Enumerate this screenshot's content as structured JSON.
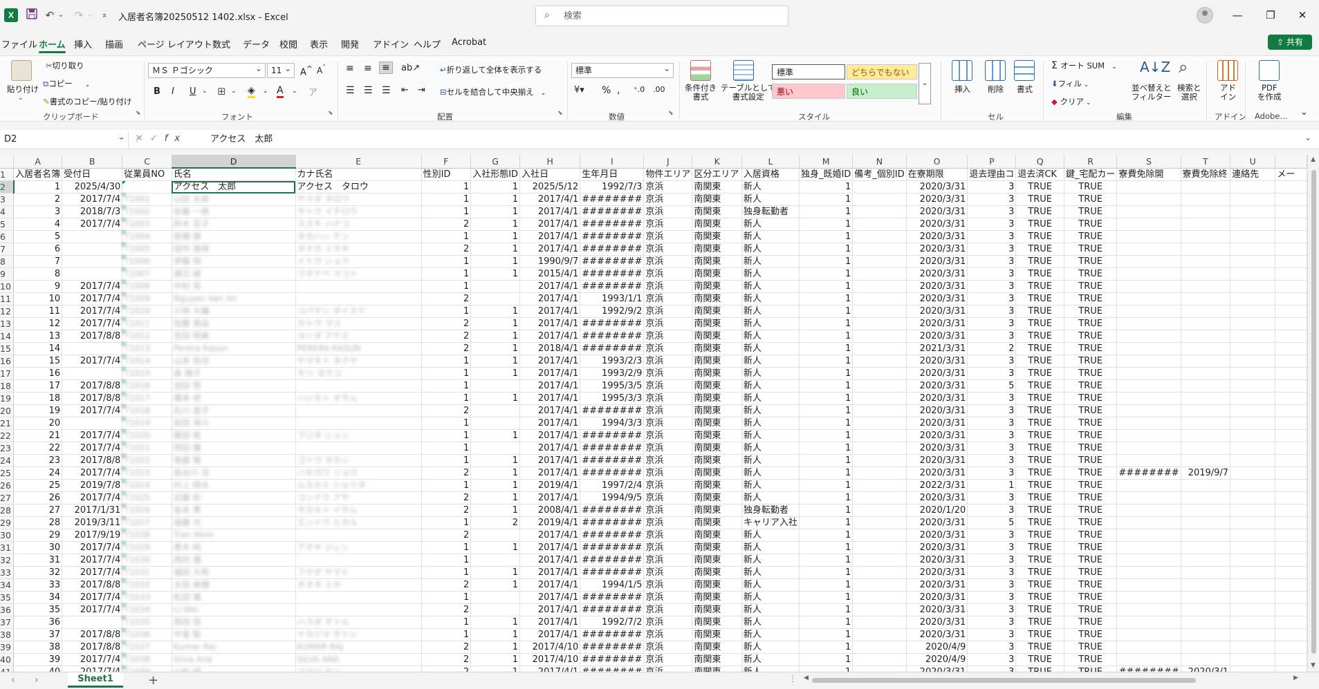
{
  "titlebar": {
    "app_logo": "X",
    "doc_title": "入居者名簿20250512 1402.xlsx  -  Excel",
    "search_placeholder": "検索"
  },
  "menu": {
    "tabs": [
      "ファイル",
      "ホーム",
      "挿入",
      "描画",
      "ページ レイアウト",
      "数式",
      "データ",
      "校閲",
      "表示",
      "開発",
      "アドイン",
      "ヘルプ",
      "Acrobat"
    ],
    "share_label": "共有"
  },
  "ribbon": {
    "clipboard": {
      "paste": "貼り付け",
      "cut": "切り取り",
      "copy": "コピー",
      "format_painter": "書式のコピー/貼り付け",
      "group": "クリップボード"
    },
    "font": {
      "name": "ＭＳ Ｐゴシック",
      "size": "11",
      "group": "フォント"
    },
    "alignment": {
      "wrap": "折り返して全体を表示する",
      "merge": "セルを結合して中央揃え",
      "group": "配置"
    },
    "number": {
      "format": "標準",
      "group": "数値"
    },
    "styles": {
      "conditional": "条件付き\n書式",
      "table": "テーブルとして\n書式設定",
      "normal": "標準",
      "neutral": "どちらでもない",
      "bad": "悪い",
      "good": "良い",
      "group": "スタイル"
    },
    "cells": {
      "insert": "挿入",
      "delete": "削除",
      "format": "書式",
      "group": "セル"
    },
    "editing": {
      "autosum": "オート SUM",
      "fill": "フィル",
      "clear": "クリア",
      "sort": "並べ替えと\nフィルター",
      "find": "検索と\n選択",
      "group": "編集"
    },
    "addins": {
      "addin": "アド\nイン",
      "group": "アドイン"
    },
    "adobe": {
      "pdf": "PDF\nを作成",
      "group": "Adobe..."
    }
  },
  "formula_bar": {
    "name_box": "D2",
    "formula": "アクセス　太郎"
  },
  "grid": {
    "columns": [
      "A",
      "B",
      "C",
      "D",
      "E",
      "F",
      "G",
      "H",
      "I",
      "J",
      "K",
      "L",
      "M",
      "N",
      "O",
      "P",
      "Q",
      "R",
      "S",
      "T",
      "U",
      ""
    ],
    "header_row": [
      "入居者名簿",
      "受付日",
      "従業員NO",
      "氏名",
      "カナ氏名",
      "性別ID",
      "入社形態ID",
      "入社日",
      "生年月日",
      "物件エリア",
      "区分エリア",
      "入居資格",
      "独身_既婚ID",
      "備考_個別ID",
      "在寮期限",
      "退去理由コ",
      "退去済CK",
      "鍵_宅配カー",
      "寮費免除開",
      "寮費免除終",
      "連絡先",
      "メー"
    ],
    "row_numbers": [
      "1",
      "2",
      "3",
      "4",
      "5",
      "6",
      "7",
      "8",
      "9",
      "10",
      "11",
      "12",
      "13",
      "14",
      "15",
      "16",
      "17",
      "18",
      "19",
      "20",
      "21",
      "22",
      "23",
      "24",
      "25",
      "26",
      "27",
      "28",
      "29",
      "30",
      "31",
      "32",
      "33",
      "34",
      "35",
      "36",
      "37",
      "38",
      "39",
      "40",
      "41"
    ],
    "rows": [
      [
        "1",
        "2025/4/30",
        "",
        "アクセス　太郎",
        "アクセス　タロウ",
        "1",
        "1",
        "2025/5/12",
        "1992/7/3",
        "京浜",
        "南関東",
        "新人",
        "1",
        "",
        "2020/3/31",
        "3",
        "TRUE",
        "TRUE",
        "",
        "",
        "",
        ""
      ],
      [
        "2",
        "2017/7/4",
        "T1001",
        "山田 太郎",
        "ヤマダ タロウ",
        "1",
        "1",
        "2017/4/1",
        "########",
        "京浜",
        "南関東",
        "新人",
        "1",
        "",
        "2020/3/31",
        "3",
        "TRUE",
        "TRUE",
        "",
        "",
        "",
        ""
      ],
      [
        "3",
        "2018/7/3",
        "T1002",
        "佐藤 一郎",
        "サトウ イチロウ",
        "1",
        "1",
        "2017/4/1",
        "########",
        "京浜",
        "南関東",
        "独身転勤者",
        "1",
        "",
        "2020/3/31",
        "3",
        "TRUE",
        "TRUE",
        "",
        "",
        "",
        ""
      ],
      [
        "4",
        "2017/7/4",
        "T1003",
        "鈴木 花子",
        "スズキ ハナコ",
        "2",
        "1",
        "2017/4/1",
        "########",
        "京浜",
        "南関東",
        "新人",
        "1",
        "",
        "2020/3/31",
        "3",
        "TRUE",
        "TRUE",
        "",
        "",
        "",
        ""
      ],
      [
        "5",
        "",
        "T1004",
        "高橋 健",
        "タカハシ ケン",
        "1",
        "1",
        "2017/4/1",
        "########",
        "京浜",
        "南関東",
        "新人",
        "1",
        "",
        "2020/3/31",
        "3",
        "TRUE",
        "TRUE",
        "",
        "",
        "",
        ""
      ],
      [
        "6",
        "",
        "T1005",
        "田中 美咲",
        "タナカ ミサキ",
        "2",
        "1",
        "2017/4/1",
        "########",
        "京浜",
        "南関東",
        "新人",
        "1",
        "",
        "2020/3/31",
        "3",
        "TRUE",
        "TRUE",
        "",
        "",
        "",
        ""
      ],
      [
        "7",
        "",
        "T1006",
        "伊藤 翔",
        "イトウ ショウ",
        "1",
        "1",
        "1990/9/7",
        "########",
        "京浜",
        "南関東",
        "新人",
        "1",
        "",
        "2020/3/31",
        "3",
        "TRUE",
        "TRUE",
        "",
        "",
        "",
        ""
      ],
      [
        "8",
        "",
        "T1007",
        "渡辺 誠",
        "ワタナベ マコト",
        "1",
        "1",
        "2015/4/1",
        "########",
        "京浜",
        "南関東",
        "新人",
        "1",
        "",
        "2020/3/31",
        "3",
        "TRUE",
        "TRUE",
        "",
        "",
        "",
        ""
      ],
      [
        "9",
        "2017/7/4",
        "T1008",
        "中村 亮",
        "",
        "1",
        "",
        "2017/4/1",
        "########",
        "京浜",
        "南関東",
        "新人",
        "1",
        "",
        "2020/3/31",
        "3",
        "TRUE",
        "TRUE",
        "",
        "",
        "",
        ""
      ],
      [
        "10",
        "2017/7/4",
        "T1009",
        "Nguyen Van An",
        "",
        "2",
        "",
        "2017/4/1",
        "1993/1/1",
        "京浜",
        "南関東",
        "新人",
        "1",
        "",
        "2020/3/31",
        "3",
        "TRUE",
        "TRUE",
        "",
        "",
        "",
        ""
      ],
      [
        "11",
        "2017/7/4",
        "T1010",
        "小林 大輔",
        "コバヤシ ダイスケ",
        "1",
        "1",
        "2017/4/1",
        "1992/9/2",
        "京浜",
        "南関東",
        "新人",
        "1",
        "",
        "2020/3/31",
        "3",
        "TRUE",
        "TRUE",
        "",
        "",
        "",
        ""
      ],
      [
        "12",
        "2017/7/4",
        "T1011",
        "加藤 真由",
        "カトウ マユ",
        "2",
        "1",
        "2017/4/1",
        "########",
        "京浜",
        "南関東",
        "新人",
        "1",
        "",
        "2020/3/31",
        "3",
        "TRUE",
        "TRUE",
        "",
        "",
        "",
        ""
      ],
      [
        "13",
        "2017/8/8",
        "T1012",
        "吉田 明美",
        "ヨシダ アケミ",
        "2",
        "1",
        "2017/4/1",
        "########",
        "京浜",
        "南関東",
        "新人",
        "1",
        "",
        "2020/3/31",
        "3",
        "TRUE",
        "TRUE",
        "",
        "",
        "",
        ""
      ],
      [
        "14",
        "",
        "T1013",
        "Perera Kasun",
        "PERERA KASUN",
        "2",
        "1",
        "2018/4/1",
        "########",
        "京浜",
        "南関東",
        "新人",
        "1",
        "",
        "2021/3/31",
        "2",
        "TRUE",
        "TRUE",
        "",
        "",
        "",
        ""
      ],
      [
        "15",
        "2017/7/4",
        "T1014",
        "山本 拓也",
        "ヤマモト タクヤ",
        "1",
        "1",
        "2017/4/1",
        "1993/2/3",
        "京浜",
        "南関東",
        "新人",
        "1",
        "",
        "2020/3/31",
        "3",
        "TRUE",
        "TRUE",
        "",
        "",
        "",
        ""
      ],
      [
        "16",
        "",
        "T1015",
        "森 陽子",
        "モリ ヨウコ",
        "1",
        "1",
        "2017/4/1",
        "1993/2/9",
        "京浜",
        "南関東",
        "新人",
        "1",
        "",
        "2020/3/31",
        "3",
        "TRUE",
        "TRUE",
        "",
        "",
        "",
        ""
      ],
      [
        "17",
        "2017/8/8",
        "T1016",
        "池田 悠",
        "",
        "1",
        "",
        "2017/4/1",
        "1995/3/5",
        "京浜",
        "南関東",
        "新人",
        "1",
        "",
        "2020/3/31",
        "5",
        "TRUE",
        "TRUE",
        "",
        "",
        "",
        ""
      ],
      [
        "18",
        "2017/8/8",
        "T1017",
        "橋本 修",
        "ハシモト オサム",
        "1",
        "1",
        "2017/4/1",
        "1995/3/3",
        "京浜",
        "南関東",
        "新人",
        "1",
        "",
        "2020/3/31",
        "3",
        "TRUE",
        "TRUE",
        "",
        "",
        "",
        ""
      ],
      [
        "19",
        "2017/7/4",
        "T1018",
        "石川 直子",
        "",
        "2",
        "",
        "2017/4/1",
        "########",
        "京浜",
        "南関東",
        "新人",
        "1",
        "",
        "2020/3/31",
        "3",
        "TRUE",
        "TRUE",
        "",
        "",
        "",
        ""
      ],
      [
        "20",
        "",
        "T1019",
        "前田 海斗",
        "",
        "1",
        "",
        "2017/4/1",
        "1994/3/3",
        "京浜",
        "南関東",
        "新人",
        "1",
        "",
        "2020/3/31",
        "3",
        "TRUE",
        "TRUE",
        "",
        "",
        "",
        ""
      ],
      [
        "21",
        "2017/7/4",
        "T1020",
        "藤田 俊",
        "フジタ シュン",
        "1",
        "1",
        "2017/4/1",
        "########",
        "京浜",
        "南関東",
        "新人",
        "1",
        "",
        "2020/3/31",
        "3",
        "TRUE",
        "TRUE",
        "",
        "",
        "",
        ""
      ],
      [
        "22",
        "2017/7/4",
        "T1021",
        "岡田 優",
        "",
        "1",
        "",
        "2017/4/1",
        "########",
        "京浜",
        "南関東",
        "新人",
        "1",
        "",
        "2020/3/31",
        "3",
        "TRUE",
        "TRUE",
        "",
        "",
        "",
        ""
      ],
      [
        "23",
        "2017/8/8",
        "T1022",
        "後藤 隆",
        "ゴトウ タカシ",
        "1",
        "1",
        "2017/4/1",
        "########",
        "京浜",
        "南関東",
        "新人",
        "1",
        "",
        "2020/3/31",
        "3",
        "TRUE",
        "TRUE",
        "",
        "",
        "",
        ""
      ],
      [
        "24",
        "2017/7/4",
        "T1023",
        "長谷川 涼",
        "ハセガワ リョウ",
        "2",
        "1",
        "2017/4/1",
        "########",
        "京浜",
        "南関東",
        "新人",
        "1",
        "",
        "2020/3/31",
        "3",
        "TRUE",
        "TRUE",
        "########",
        "2019/9/7",
        "",
        ""
      ],
      [
        "25",
        "2019/7/8",
        "T1024",
        "村上 翔太",
        "ムラカミ ショウタ",
        "1",
        "1",
        "2019/4/1",
        "1997/2/4",
        "京浜",
        "南関東",
        "新人",
        "1",
        "",
        "2022/3/31",
        "1",
        "TRUE",
        "TRUE",
        "",
        "",
        "",
        ""
      ],
      [
        "26",
        "2017/7/4",
        "T1025",
        "近藤 彩",
        "コンドウ アヤ",
        "2",
        "1",
        "2017/4/1",
        "1994/9/5",
        "京浜",
        "南関東",
        "新人",
        "1",
        "",
        "2020/3/31",
        "3",
        "TRUE",
        "TRUE",
        "",
        "",
        "",
        ""
      ],
      [
        "27",
        "2017/1/31",
        "T1026",
        "坂本 勇",
        "サカモト イサム",
        "2",
        "1",
        "2008/4/1",
        "########",
        "京浜",
        "南関東",
        "独身転勤者",
        "1",
        "",
        "2020/1/20",
        "3",
        "TRUE",
        "TRUE",
        "",
        "",
        "",
        ""
      ],
      [
        "28",
        "2019/3/11",
        "T1027",
        "遠藤 光",
        "エンドウ ヒカル",
        "1",
        "2",
        "2019/4/1",
        "########",
        "京浜",
        "南関東",
        "キャリア入社",
        "1",
        "",
        "2020/3/31",
        "5",
        "TRUE",
        "TRUE",
        "",
        "",
        "",
        ""
      ],
      [
        "29",
        "2017/9/19",
        "T1028",
        "Tran Minh",
        "",
        "2",
        "",
        "2017/4/1",
        "########",
        "京浜",
        "南関東",
        "新人",
        "1",
        "",
        "2020/3/31",
        "3",
        "TRUE",
        "TRUE",
        "",
        "",
        "",
        ""
      ],
      [
        "30",
        "2017/7/4",
        "T1029",
        "青木 純",
        "アオキ ジュン",
        "1",
        "1",
        "2017/4/1",
        "########",
        "京浜",
        "南関東",
        "新人",
        "1",
        "",
        "2020/3/31",
        "3",
        "TRUE",
        "TRUE",
        "",
        "",
        "",
        ""
      ],
      [
        "31",
        "2017/7/4",
        "T1030",
        "西村 蓮",
        "",
        "1",
        "",
        "2017/4/1",
        "########",
        "京浜",
        "南関東",
        "新人",
        "1",
        "",
        "2020/3/31",
        "3",
        "TRUE",
        "TRUE",
        "",
        "",
        "",
        ""
      ],
      [
        "32",
        "2017/7/4",
        "T1031",
        "福田 大和",
        "フクダ ヤマト",
        "1",
        "1",
        "2017/4/1",
        "########",
        "京浜",
        "南関東",
        "新人",
        "1",
        "",
        "2020/3/31",
        "3",
        "TRUE",
        "TRUE",
        "",
        "",
        "",
        ""
      ],
      [
        "33",
        "2017/8/8",
        "T1032",
        "太田 美穂",
        "オオタ ミホ",
        "2",
        "1",
        "2017/4/1",
        "1994/1/5",
        "京浜",
        "南関東",
        "新人",
        "1",
        "",
        "2020/3/31",
        "3",
        "TRUE",
        "TRUE",
        "",
        "",
        "",
        ""
      ],
      [
        "34",
        "2017/7/4",
        "T1033",
        "松田 颯",
        "",
        "1",
        "",
        "2017/4/1",
        "########",
        "京浜",
        "南関東",
        "新人",
        "1",
        "",
        "2020/3/31",
        "3",
        "TRUE",
        "TRUE",
        "",
        "",
        "",
        ""
      ],
      [
        "35",
        "2017/7/4",
        "T1034",
        "Li Wei",
        "",
        "2",
        "",
        "2017/4/1",
        "########",
        "京浜",
        "南関東",
        "新人",
        "1",
        "",
        "2020/3/31",
        "3",
        "TRUE",
        "TRUE",
        "",
        "",
        "",
        ""
      ],
      [
        "36",
        "",
        "T1035",
        "原田 悟",
        "ハラダ サトル",
        "1",
        "1",
        "2017/4/1",
        "1992/7/2",
        "京浜",
        "南関東",
        "新人",
        "1",
        "",
        "2020/3/31",
        "3",
        "TRUE",
        "TRUE",
        "",
        "",
        "",
        ""
      ],
      [
        "37",
        "2017/8/8",
        "T1036",
        "中島 聡",
        "ナカジマ サトシ",
        "1",
        "1",
        "2017/4/1",
        "########",
        "京浜",
        "南関東",
        "新人",
        "1",
        "",
        "2020/3/31",
        "3",
        "TRUE",
        "TRUE",
        "",
        "",
        "",
        ""
      ],
      [
        "38",
        "2017/8/8",
        "T1037",
        "Kumar Raj",
        "KUMAR RAJ",
        "2",
        "1",
        "2017/4/10",
        "########",
        "京浜",
        "南関東",
        "新人",
        "1",
        "",
        "2020/4/9",
        "3",
        "TRUE",
        "TRUE",
        "",
        "",
        "",
        ""
      ],
      [
        "39",
        "2017/7/4",
        "T1038",
        "Silva Ana",
        "SILVA ANA",
        "2",
        "1",
        "2017/4/10",
        "########",
        "京浜",
        "南関東",
        "新人",
        "1",
        "",
        "2020/4/9",
        "3",
        "TRUE",
        "TRUE",
        "",
        "",
        "",
        ""
      ],
      [
        "40",
        "2017/7/4",
        "T1039",
        "小松 研",
        "コマツ ケン",
        "2",
        "1",
        "2017/4/1",
        "########",
        "京浜",
        "南関東",
        "新人",
        "1",
        "",
        "2020/3/31",
        "3",
        "TRUE",
        "TRUE",
        "########",
        "2020/3/1",
        "",
        ""
      ]
    ]
  },
  "sheets": {
    "active": "Sheet1"
  },
  "colors": {
    "accent": "#107c41",
    "selection": "#217346"
  }
}
